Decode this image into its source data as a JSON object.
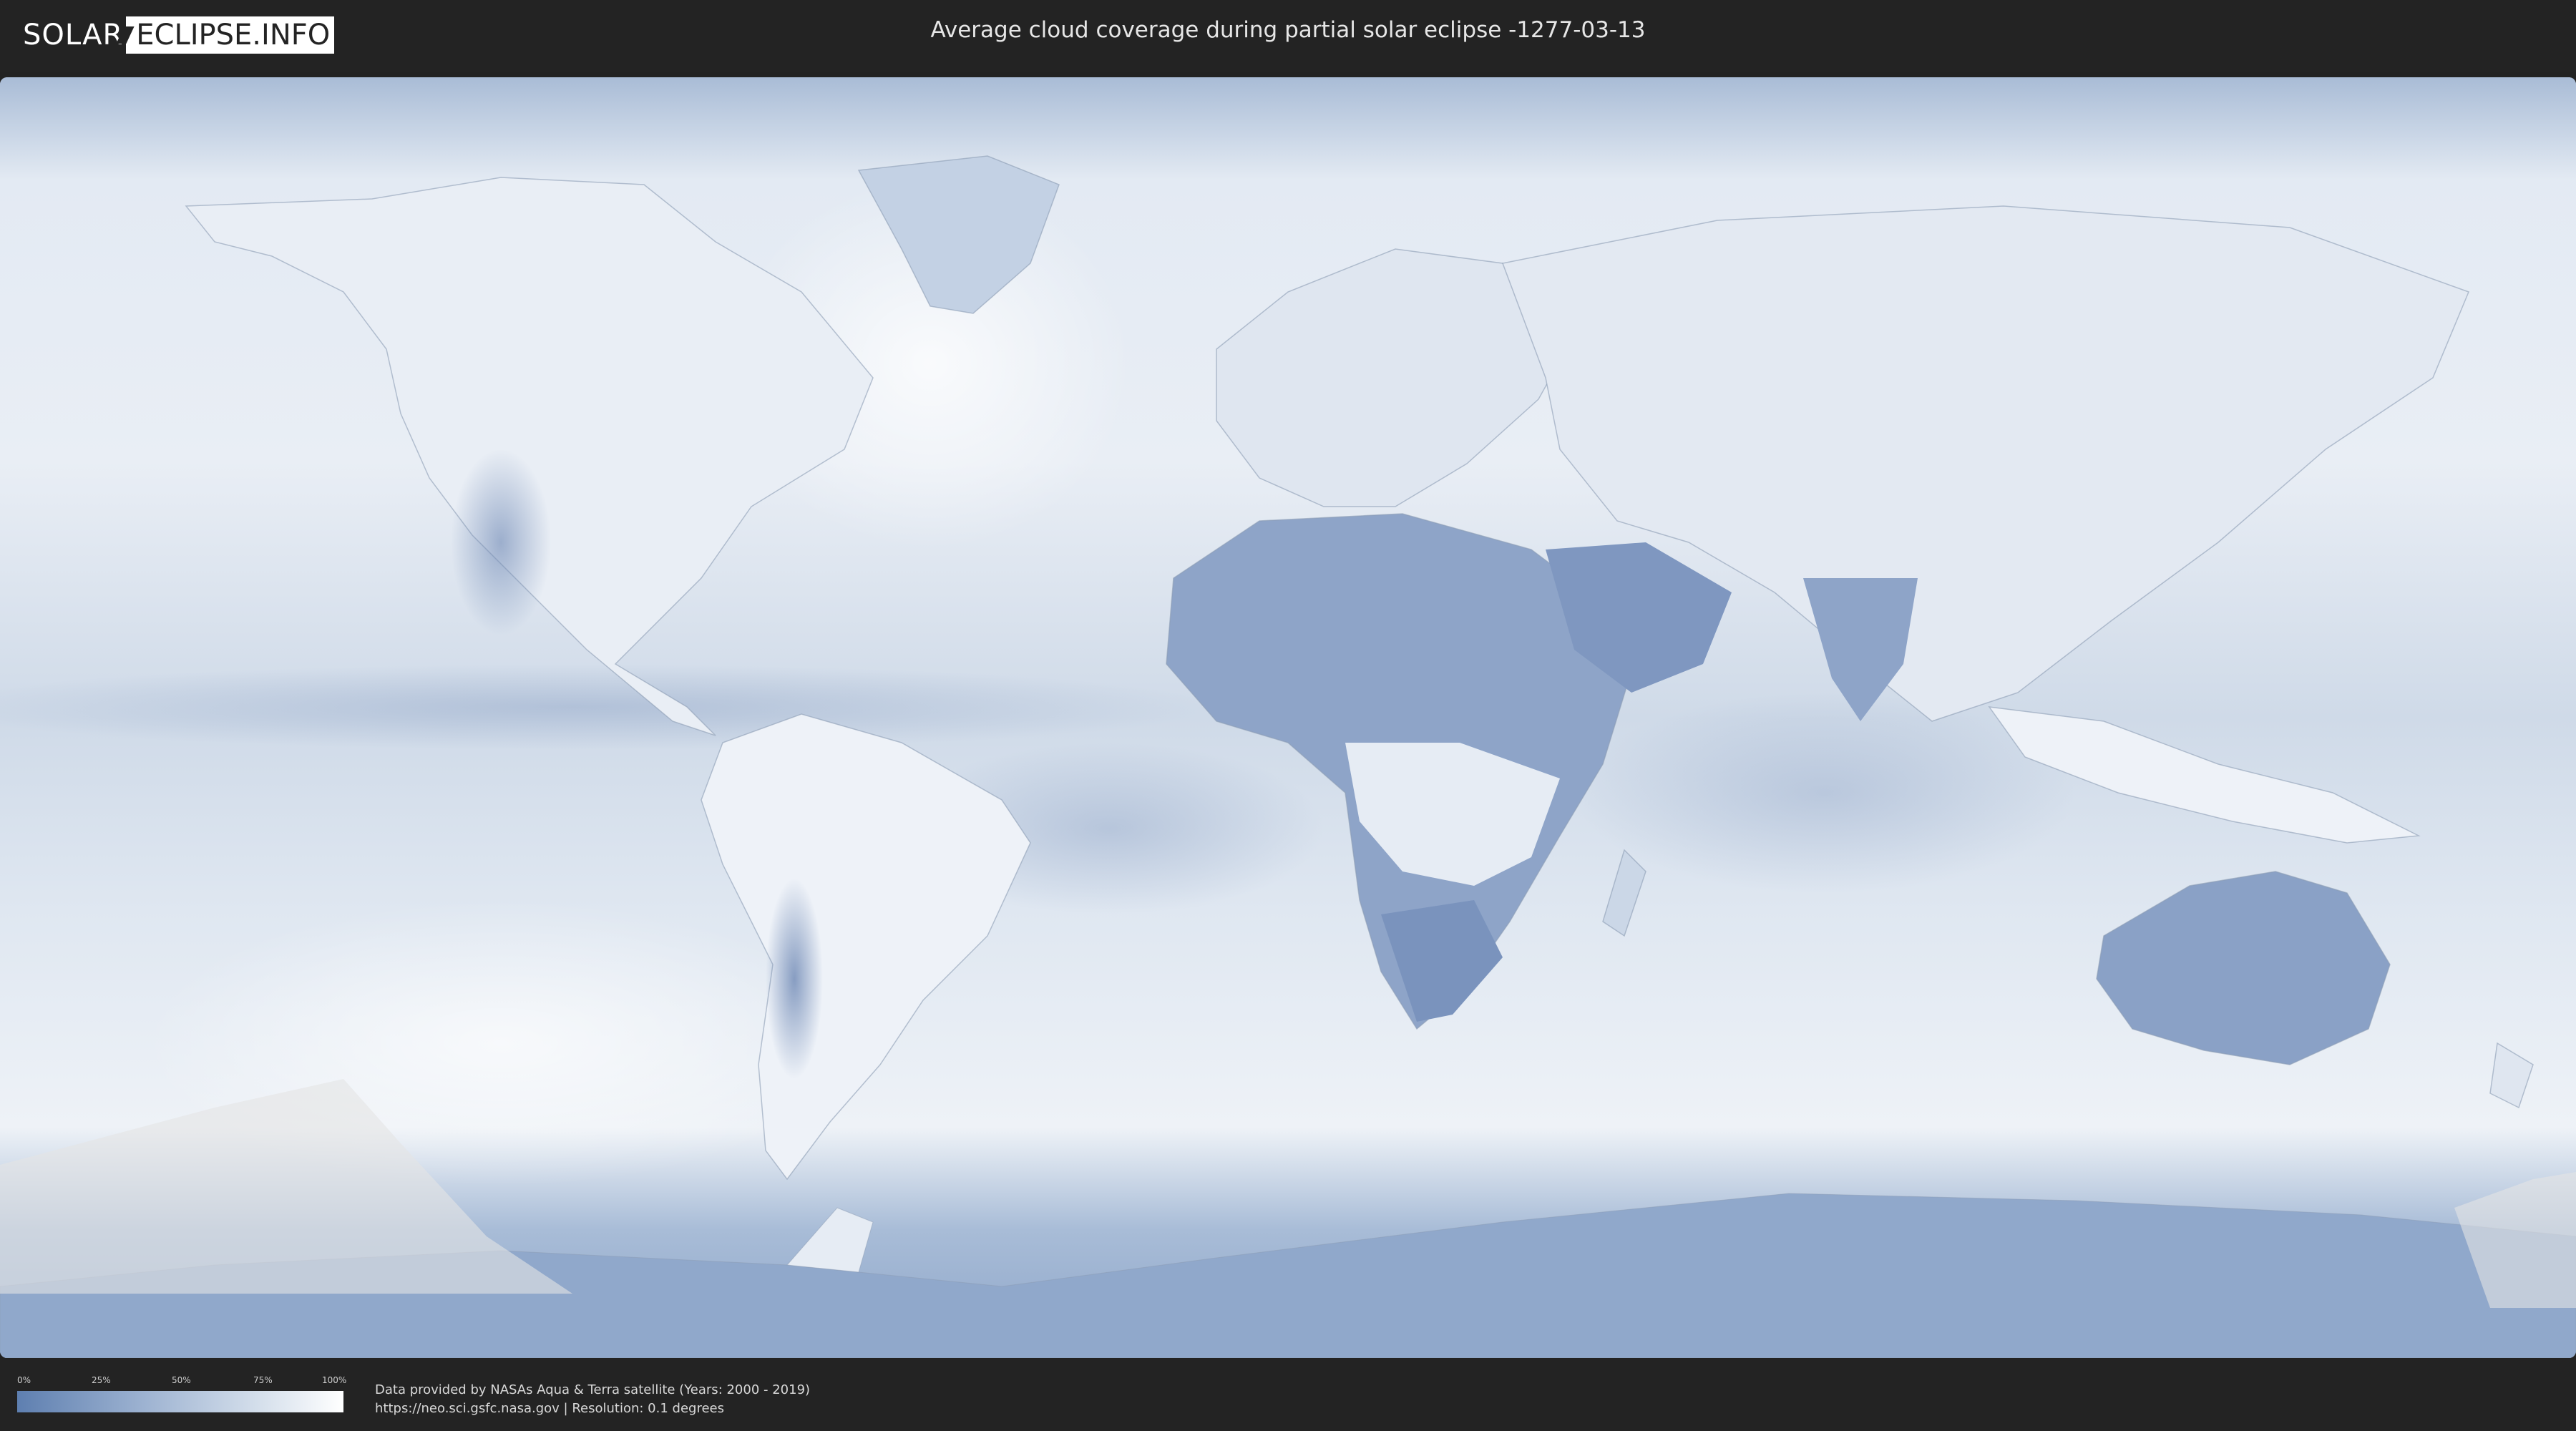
{
  "header": {
    "logo_left": "SOLAR",
    "logo_right": "ECLIPSE.INFO",
    "title": "Average cloud coverage during partial solar eclipse -1277-03-13"
  },
  "legend": {
    "ticks": [
      "0%",
      "25%",
      "50%",
      "75%",
      "100%"
    ],
    "color_low": "#5e7fb0",
    "color_high": "#ffffff"
  },
  "footer": {
    "credit_line1": "Data provided by NASAs Aqua & Terra satellite (Years: 2000 - 2019)",
    "credit_line2": "https://neo.sci.gsfc.nasa.gov | Resolution: 0.1 degrees"
  },
  "map": {
    "ocean_color": "#d3dde9",
    "land_cloudy_color": "#eef2f8",
    "land_clear_color": "#7b94bd",
    "eclipse_overlay_color": "#e4e4e4"
  }
}
